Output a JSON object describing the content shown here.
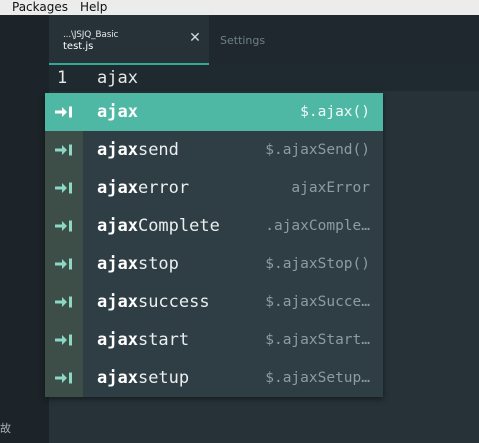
{
  "menubar": {
    "items": [
      "Packages",
      "Help"
    ]
  },
  "left_dock": {
    "edge_text": "故"
  },
  "tabs": [
    {
      "path": "...\\JSJQ_Basic",
      "file": "test.js",
      "active": true
    },
    {
      "label": "Settings",
      "active": false
    }
  ],
  "editor": {
    "line_number": "1",
    "code": "ajax"
  },
  "autocomplete": {
    "accent": "#4fb8a5",
    "icon": "snippet-arrow-icon",
    "items": [
      {
        "match": "ajax",
        "rest": "",
        "right": "$.ajax()"
      },
      {
        "match": "ajax",
        "rest": "send",
        "right": "$.ajaxSend()"
      },
      {
        "match": "ajax",
        "rest": "error",
        "right": "ajaxError"
      },
      {
        "match": "ajax",
        "rest": "Complete",
        "right": ".ajaxComple…"
      },
      {
        "match": "ajax",
        "rest": "stop",
        "right": "$.ajaxStop()"
      },
      {
        "match": "ajax",
        "rest": "success",
        "right": "$.ajaxSucce…"
      },
      {
        "match": "ajax",
        "rest": "start",
        "right": "$.ajaxStart…"
      },
      {
        "match": "ajax",
        "rest": "setup",
        "right": "$.ajaxSetup…"
      }
    ]
  }
}
